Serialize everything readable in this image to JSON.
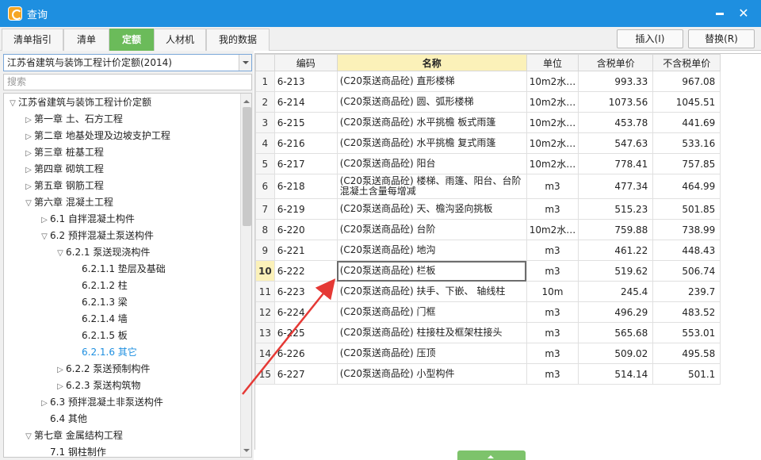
{
  "window": {
    "title": "查询"
  },
  "tabs": [
    "清单指引",
    "清单",
    "定额",
    "人材机",
    "我的数据"
  ],
  "active_tab": 2,
  "toolbar": {
    "insert_label": "插入(I)",
    "replace_label": "替换(R)"
  },
  "left": {
    "quota_library": "江苏省建筑与装饰工程计价定额(2014)",
    "search_placeholder": "搜索",
    "tree": [
      {
        "toggle": "▽",
        "label": "江苏省建筑与装饰工程计价定额"
      },
      {
        "toggle": "▷",
        "label": "第一章 土、石方工程"
      },
      {
        "toggle": "▷",
        "label": "第二章 地基处理及边坡支护工程"
      },
      {
        "toggle": "▷",
        "label": "第三章 桩基工程"
      },
      {
        "toggle": "▷",
        "label": "第四章 砌筑工程"
      },
      {
        "toggle": "▷",
        "label": "第五章 钢筋工程"
      },
      {
        "toggle": "▽",
        "label": "第六章 混凝土工程"
      },
      {
        "toggle": "▷",
        "label": "6.1 自拌混凝土构件"
      },
      {
        "toggle": "▽",
        "label": "6.2 预拌混凝土泵送构件"
      },
      {
        "toggle": "▽",
        "label": "6.2.1 泵送现浇构件"
      },
      {
        "toggle": "",
        "label": "6.2.1.1 垫层及基础"
      },
      {
        "toggle": "",
        "label": "6.2.1.2 柱"
      },
      {
        "toggle": "",
        "label": "6.2.1.3 梁"
      },
      {
        "toggle": "",
        "label": "6.2.1.4 墙"
      },
      {
        "toggle": "",
        "label": "6.2.1.5 板"
      },
      {
        "toggle": "",
        "label": "6.2.1.6 其它"
      },
      {
        "toggle": "▷",
        "label": "6.2.2 泵送预制构件"
      },
      {
        "toggle": "▷",
        "label": "6.2.3 泵送构筑物"
      },
      {
        "toggle": "▷",
        "label": "6.3 预拌混凝土非泵送构件"
      },
      {
        "toggle": "",
        "label": "6.4 其他"
      },
      {
        "toggle": "▽",
        "label": "第七章 金属结构工程"
      },
      {
        "toggle": "",
        "label": "7.1 钢柱制作"
      }
    ],
    "selected_index": 15
  },
  "grid": {
    "headers": [
      "",
      "编码",
      "名称",
      "单位",
      "含税单价",
      "不含税单价"
    ],
    "current_row": 9,
    "rows": [
      {
        "num": "1",
        "code": "6-213",
        "name": "(C20泵送商品砼) 直形楼梯",
        "unit": "10m2水…",
        "tax_price": "993.33",
        "notax_price": "967.08"
      },
      {
        "num": "2",
        "code": "6-214",
        "name": "(C20泵送商品砼) 圆、弧形楼梯",
        "unit": "10m2水…",
        "tax_price": "1073.56",
        "notax_price": "1045.51"
      },
      {
        "num": "3",
        "code": "6-215",
        "name": "(C20泵送商品砼) 水平挑檐 板式雨篷",
        "unit": "10m2水…",
        "tax_price": "453.78",
        "notax_price": "441.69"
      },
      {
        "num": "4",
        "code": "6-216",
        "name": "(C20泵送商品砼) 水平挑檐 复式雨篷",
        "unit": "10m2水…",
        "tax_price": "547.63",
        "notax_price": "533.16"
      },
      {
        "num": "5",
        "code": "6-217",
        "name": "(C20泵送商品砼) 阳台",
        "unit": "10m2水…",
        "tax_price": "778.41",
        "notax_price": "757.85"
      },
      {
        "num": "6",
        "code": "6-218",
        "name": "(C20泵送商品砼) 楼梯、雨篷、阳台、台阶混凝土含量每增减",
        "unit": "m3",
        "tax_price": "477.34",
        "notax_price": "464.99"
      },
      {
        "num": "7",
        "code": "6-219",
        "name": "(C20泵送商品砼) 天、檐沟竖向挑板",
        "unit": "m3",
        "tax_price": "515.23",
        "notax_price": "501.85"
      },
      {
        "num": "8",
        "code": "6-220",
        "name": "(C20泵送商品砼) 台阶",
        "unit": "10m2水…",
        "tax_price": "759.88",
        "notax_price": "738.99"
      },
      {
        "num": "9",
        "code": "6-221",
        "name": "(C20泵送商品砼) 地沟",
        "unit": "m3",
        "tax_price": "461.22",
        "notax_price": "448.43"
      },
      {
        "num": "10",
        "code": "6-222",
        "name": "(C20泵送商品砼) 栏板",
        "unit": "m3",
        "tax_price": "519.62",
        "notax_price": "506.74"
      },
      {
        "num": "11",
        "code": "6-223",
        "name": "(C20泵送商品砼) 扶手、下嵌、 轴线柱",
        "unit": "10m",
        "tax_price": "245.4",
        "notax_price": "239.7"
      },
      {
        "num": "12",
        "code": "6-224",
        "name": "(C20泵送商品砼) 门框",
        "unit": "m3",
        "tax_price": "496.29",
        "notax_price": "483.52"
      },
      {
        "num": "13",
        "code": "6-225",
        "name": "(C20泵送商品砼) 柱接柱及框架柱接头",
        "unit": "m3",
        "tax_price": "565.68",
        "notax_price": "553.01"
      },
      {
        "num": "14",
        "code": "6-226",
        "name": "(C20泵送商品砼) 压顶",
        "unit": "m3",
        "tax_price": "509.02",
        "notax_price": "495.58"
      },
      {
        "num": "15",
        "code": "6-227",
        "name": "(C20泵送商品砼) 小型构件",
        "unit": "m3",
        "tax_price": "514.14",
        "notax_price": "501.1"
      }
    ]
  },
  "colors": {
    "titlebar": "#1e8fe0",
    "active_tab": "#6bbb5a",
    "selected_tree": "#1e8fe0",
    "annotation_arrow": "#e53935"
  }
}
